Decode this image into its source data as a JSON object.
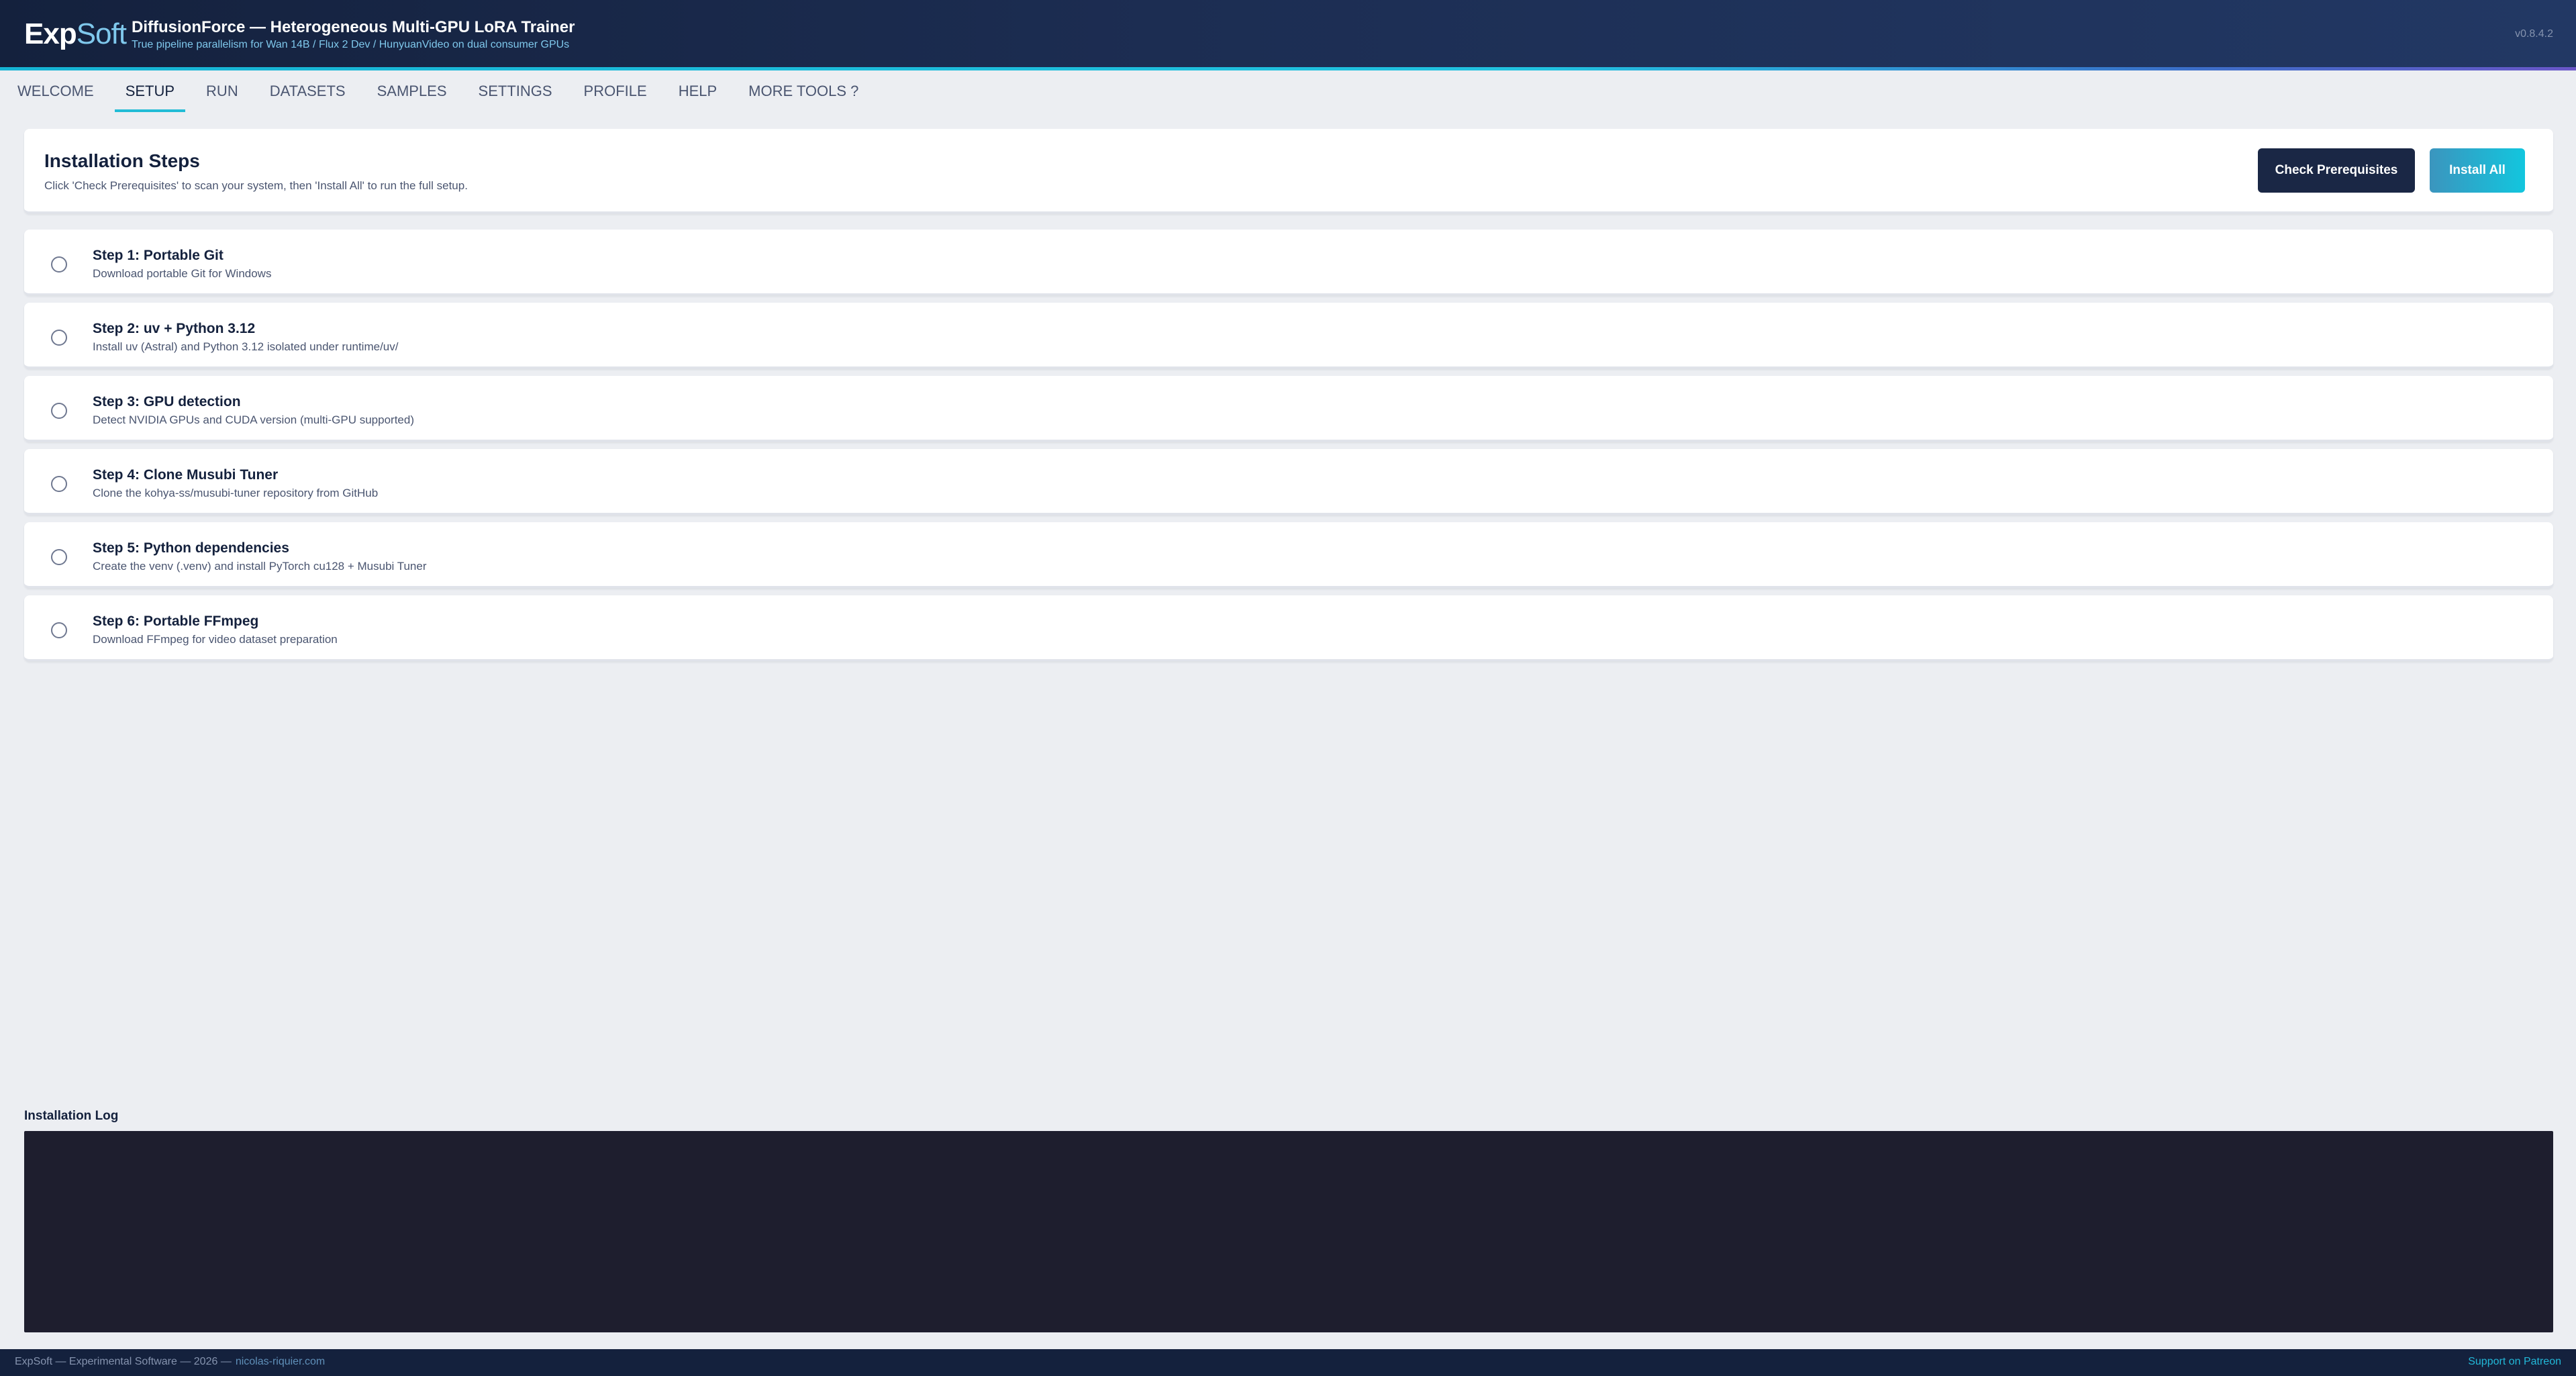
{
  "header": {
    "logo_bold": "Exp",
    "logo_light": "Soft",
    "title": "DiffusionForce — Heterogeneous Multi-GPU LoRA Trainer",
    "subtitle": "True pipeline parallelism for Wan 14B / Flux 2 Dev / HunyuanVideo on dual consumer GPUs",
    "version": "v0.8.4.2"
  },
  "tabs": [
    {
      "label": "WELCOME",
      "active": false
    },
    {
      "label": "SETUP",
      "active": true
    },
    {
      "label": "RUN",
      "active": false
    },
    {
      "label": "DATASETS",
      "active": false
    },
    {
      "label": "SAMPLES",
      "active": false
    },
    {
      "label": "SETTINGS",
      "active": false
    },
    {
      "label": "PROFILE",
      "active": false
    },
    {
      "label": "HELP",
      "active": false
    },
    {
      "label": "MORE TOOLS ?",
      "active": false
    }
  ],
  "install": {
    "title": "Installation Steps",
    "description": "Click 'Check Prerequisites' to scan your system, then 'Install All' to run the full setup.",
    "check_button": "Check Prerequisites",
    "install_button": "Install All"
  },
  "steps": [
    {
      "title": "Step 1: Portable Git",
      "description": "Download portable Git for Windows",
      "checked": false
    },
    {
      "title": "Step 2: uv + Python 3.12",
      "description": "Install uv (Astral) and Python 3.12 isolated under runtime/uv/",
      "checked": false
    },
    {
      "title": "Step 3: GPU detection",
      "description": "Detect NVIDIA GPUs and CUDA version (multi-GPU supported)",
      "checked": false
    },
    {
      "title": "Step 4: Clone Musubi Tuner",
      "description": "Clone the kohya-ss/musubi-tuner repository from GitHub",
      "checked": false
    },
    {
      "title": "Step 5: Python dependencies",
      "description": "Create the venv (.venv) and install PyTorch cu128 + Musubi Tuner",
      "checked": false
    },
    {
      "title": "Step 6: Portable FFmpeg",
      "description": "Download FFmpeg for video dataset preparation",
      "checked": false
    }
  ],
  "log": {
    "label": "Installation Log",
    "content": ""
  },
  "footer": {
    "left_text": "ExpSoft — Experimental Software — 2026 —",
    "link": "nicolas-riquier.com",
    "right_link": "Support on Patreon"
  },
  "colors": {
    "header_bg": "#14213d",
    "accent": "#22bcd6",
    "page_bg": "#eceef2",
    "log_bg": "#1e1e2e"
  }
}
